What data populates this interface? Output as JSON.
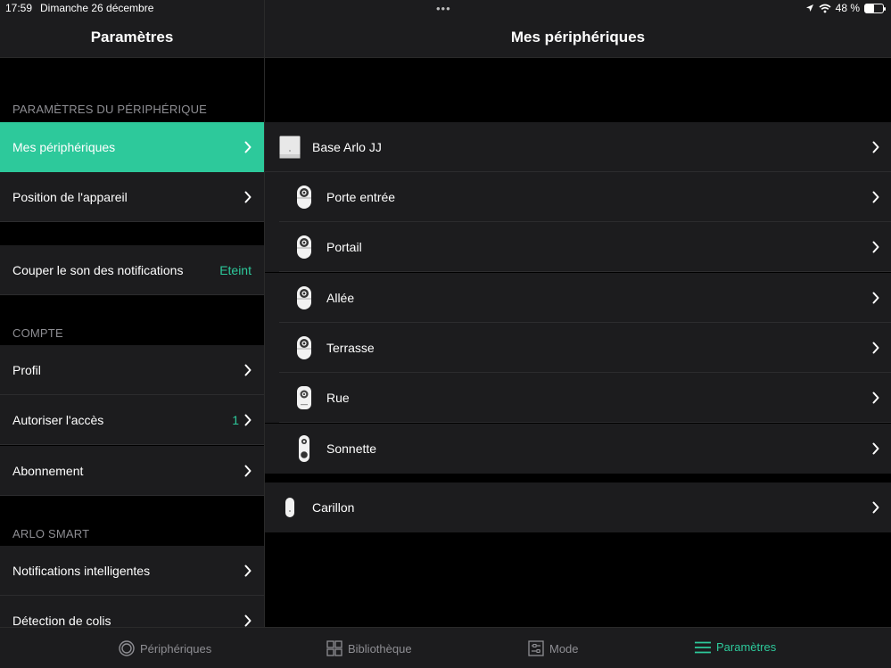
{
  "status_bar": {
    "time": "17:59",
    "date": "Dimanche 26 décembre",
    "battery": "48 %",
    "battery_level": 0.48
  },
  "left": {
    "title": "Paramètres",
    "sections": {
      "device_settings": "PARAMÈTRES DU PÉRIPHÉRIQUE",
      "account": "COMPTE",
      "arlo_smart": "ARLO SMART"
    },
    "items": {
      "my_devices": "Mes périphériques",
      "device_position": "Position de l'appareil",
      "mute_notifications": "Couper le son des notifications",
      "mute_value": "Eteint",
      "profile": "Profil",
      "grant_access": "Autoriser l'accès",
      "grant_access_count": "1",
      "subscription": "Abonnement",
      "smart_notifications": "Notifications intelligentes",
      "package_detection": "Détection de colis"
    }
  },
  "right": {
    "title": "Mes périphériques",
    "base": "Base Arlo JJ",
    "cameras": [
      "Porte entrée",
      "Portail",
      "Allée",
      "Terrasse",
      "Rue"
    ],
    "doorbell": "Sonnette",
    "chime": "Carillon"
  },
  "tabs": {
    "devices": "Périphériques",
    "library": "Bibliothèque",
    "mode": "Mode",
    "settings": "Paramètres"
  },
  "colors": {
    "accent": "#2dc99b",
    "row_bg": "#1c1c1e",
    "background": "#000000",
    "secondary_text": "#8e8e93"
  }
}
